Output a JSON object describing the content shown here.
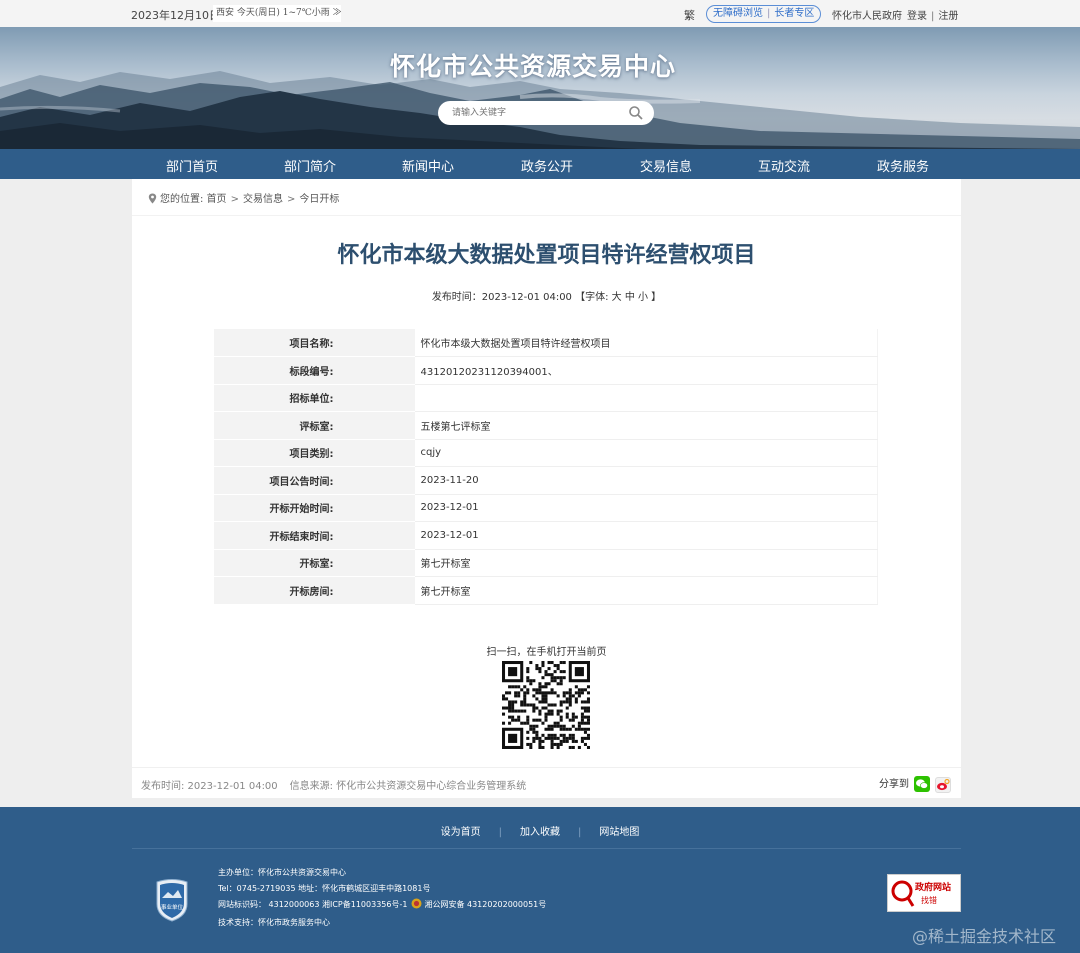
{
  "topbar": {
    "date": "2023年12月10日",
    "weather": "西安  今天(周日) 1~7℃小雨 ≫",
    "traditional": "繁",
    "accessible": "无障碍浏览",
    "elder": "长者专区",
    "gov_link": "怀化市人民政府",
    "login": "登录",
    "register": "注册"
  },
  "header": {
    "title": "怀化市公共资源交易中心",
    "search_placeholder": "请输入关键字"
  },
  "nav": [
    "部门首页",
    "部门简介",
    "新闻中心",
    "政务公开",
    "交易信息",
    "互动交流",
    "政务服务"
  ],
  "breadcrumb": {
    "prefix": "您的位置:",
    "items": [
      "首页",
      "交易信息",
      "今日开标"
    ]
  },
  "article": {
    "title": "怀化市本级大数据处置项目特许经营权项目",
    "meta": "发布时间：2023-12-01 04:00 【字体: 大 中 小 】",
    "rows": [
      {
        "key": "项目名称:",
        "value": "怀化市本级大数据处置项目特许经营权项目"
      },
      {
        "key": "标段编号:",
        "value": "43120120231120394001、"
      },
      {
        "key": "招标单位:",
        "value": ""
      },
      {
        "key": "评标室:",
        "value": "五楼第七评标室"
      },
      {
        "key": "项目类别:",
        "value": "cqjy"
      },
      {
        "key": "项目公告时间:",
        "value": "2023-11-20"
      },
      {
        "key": "开标开始时间:",
        "value": "2023-12-01"
      },
      {
        "key": "开标结束时间:",
        "value": "2023-12-01"
      },
      {
        "key": "开标室:",
        "value": "第七开标室"
      },
      {
        "key": "开标房间:",
        "value": "第七开标室"
      }
    ],
    "qr_label": "扫一扫，在手机打开当前页",
    "pub_time": "发布时间: 2023-12-01 04:00",
    "source": "信息来源: 怀化市公共资源交易中心综合业务管理系统",
    "share_label": "分享到"
  },
  "footer": {
    "links": [
      "设为首页",
      "加入收藏",
      "网站地图"
    ],
    "host": "主办单位：怀化市公共资源交易中心",
    "contact": "Tel：0745-2719035 地址：怀化市鹤城区迎丰中路1081号",
    "site_code": "网站标识码：  4312000063  湘ICP备11003356号-1",
    "police": "湘公网安备 43120202000051号",
    "tech": "技术支持：怀化市政务服务中心",
    "badge_text": "事业单位",
    "gov_err_1": "政府网站",
    "gov_err_2": "找错"
  },
  "watermark": "@稀土掘金技术社区",
  "colors": {
    "nav": "#2f5d8a",
    "title": "#2d4f6f"
  }
}
